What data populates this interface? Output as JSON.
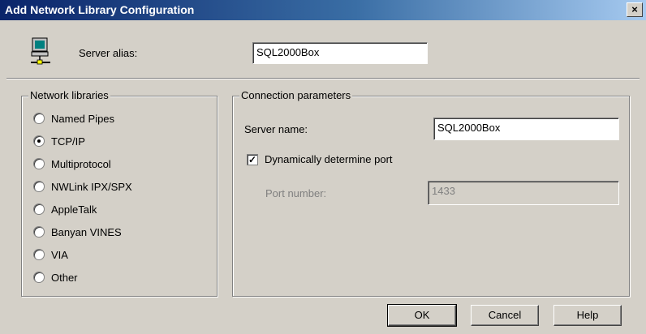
{
  "window": {
    "title": "Add Network Library Configuration",
    "close_label": "×"
  },
  "server_alias": {
    "label": "Server alias:",
    "value": "SQL2000Box"
  },
  "network_libraries": {
    "title": "Network libraries",
    "selected": "TCP/IP",
    "options": [
      {
        "label": "Named Pipes"
      },
      {
        "label": "TCP/IP"
      },
      {
        "label": "Multiprotocol"
      },
      {
        "label": "NWLink IPX/SPX"
      },
      {
        "label": "AppleTalk"
      },
      {
        "label": "Banyan VINES"
      },
      {
        "label": "VIA"
      },
      {
        "label": "Other"
      }
    ]
  },
  "connection_parameters": {
    "title": "Connection parameters",
    "server_name": {
      "label": "Server name:",
      "value": "SQL2000Box"
    },
    "dynamic_port": {
      "label": "Dynamically determine port",
      "checked": true
    },
    "port_number": {
      "label": "Port number:",
      "value": "1433",
      "disabled": true
    }
  },
  "buttons": {
    "ok": "OK",
    "cancel": "Cancel",
    "help": "Help"
  },
  "colors": {
    "title_start": "#0a246a",
    "title_end": "#a6caf0",
    "face": "#d4d0c8"
  },
  "icons": {
    "server": "computer-network-icon"
  }
}
